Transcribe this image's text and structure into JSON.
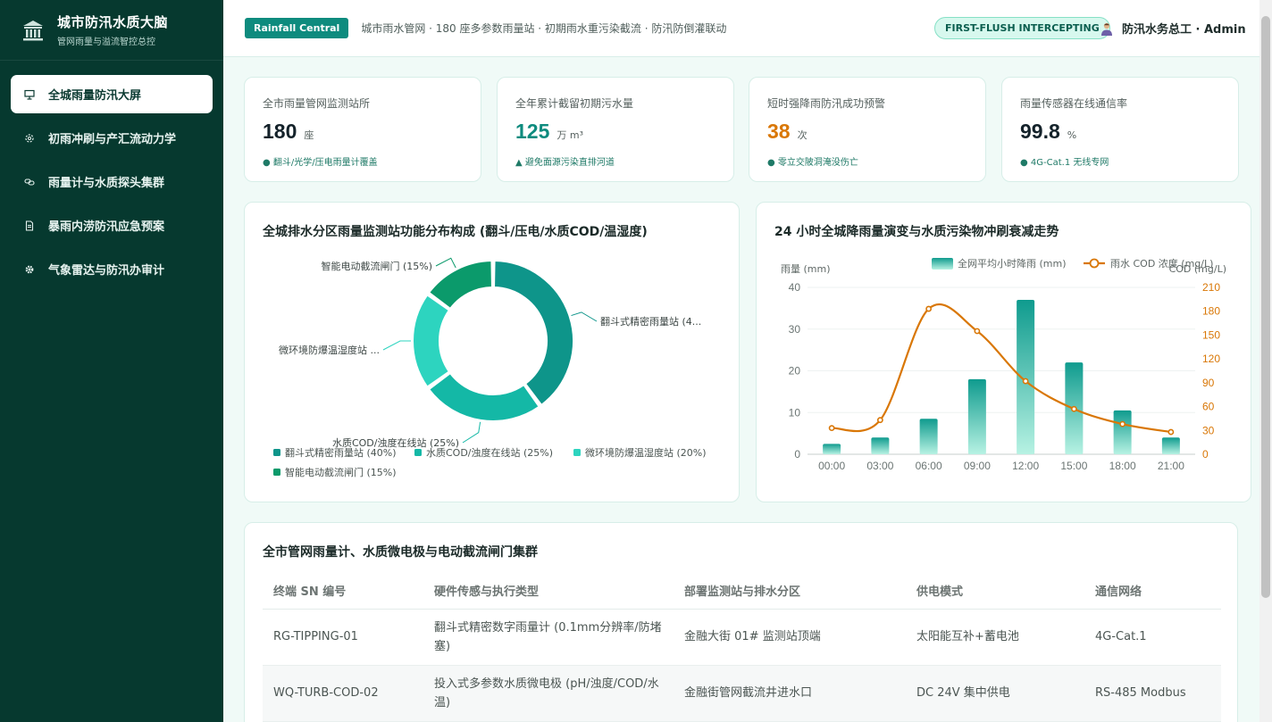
{
  "brand": {
    "title": "城市防汛水质大脑",
    "subtitle": "管网雨量与溢流智控总控"
  },
  "sidebar": {
    "items": [
      {
        "label": "全城雨量防汛大屏",
        "icon": "presentation-icon",
        "active": true
      },
      {
        "label": "初雨冲刷与产汇流动力学",
        "icon": "gear-dashed-icon",
        "active": false
      },
      {
        "label": "雨量计与水质探头集群",
        "icon": "link-icon",
        "active": false
      },
      {
        "label": "暴雨内涝防汛应急预案",
        "icon": "document-icon",
        "active": false
      },
      {
        "label": "气象雷达与防汛办审计",
        "icon": "gear-icon",
        "active": false
      }
    ]
  },
  "header": {
    "badge": "Rainfall Central",
    "description": "城市雨水管网 · 180 座多参数雨量站 · 初期雨水重污染截流 · 防汛防倒灌联动",
    "status": "FIRST-FLUSH INTERCEPTING",
    "user": "防汛水务总工 · Admin"
  },
  "kpis": [
    {
      "label": "全市雨量管网监测站所",
      "value": "180",
      "unit": "座",
      "foot": "● 翻斗/光学/压电雨量计覆盖",
      "color": "#14222a"
    },
    {
      "label": "全年累计截留初期污水量",
      "value": "125",
      "unit": "万 m³",
      "foot": "▲ 避免面源污染直排河道",
      "color": "#0e8b7e"
    },
    {
      "label": "短时强降雨防汛成功预警",
      "value": "38",
      "unit": "次",
      "foot": "● 零立交陂洞淹没伤亡",
      "color": "#d97706"
    },
    {
      "label": "雨量传感器在线通信率",
      "value": "99.8",
      "unit": "%",
      "foot": "● 4G-Cat.1 无线专网",
      "color": "#14222a"
    }
  ],
  "donut": {
    "title": "全城排水分区雨量监测站功能分布构成 (翻斗/压电/水质COD/温湿度)",
    "callouts": [
      "翻斗式精密雨量站 (4...",
      "水质COD/浊度在线站 (25%)",
      "微环境防爆温湿度站 ...",
      "智能电动截流闸门 (15%)"
    ],
    "legend": [
      "翻斗式精密雨量站 (40%)",
      "水质COD/浊度在线站 (25%)",
      "微环境防爆温湿度站 (20%)",
      "智能电动截流闸门 (15%)"
    ]
  },
  "trend": {
    "title": "24 小时全城降雨量演变与水质污染物冲刷衰减走势",
    "y_left_label": "雨量 (mm)",
    "y_right_label": "COD (mg/L)",
    "legend_bar": "全网平均小时降雨 (mm)",
    "legend_line": "雨水 COD 浓度 (mg/L)"
  },
  "table": {
    "title": "全市管网雨量计、水质微电极与电动截流闸门集群",
    "headers": [
      "终端 SN 编号",
      "硬件传感与执行类型",
      "部署监测站与排水分区",
      "供电模式",
      "通信网络"
    ],
    "rows": [
      [
        "RG-TIPPING-01",
        "翻斗式精密数字雨量计 (0.1mm分辨率/防堵塞)",
        "金融大街 01# 监测站顶端",
        "太阳能互补+蓄电池",
        "4G-Cat.1"
      ],
      [
        "WQ-TURB-COD-02",
        "投入式多参数水质微电极 (pH/浊度/COD/水温)",
        "金融街管网截流井进水口",
        "DC 24V 集中供电",
        "RS-485 Modbus"
      ]
    ]
  },
  "chart_data": [
    {
      "type": "pie",
      "title": "全城排水分区雨量监测站功能分布构成 (翻斗/压电/水质COD/温湿度)",
      "categories": [
        "翻斗式精密雨量站",
        "水质COD/浊度在线站",
        "微环境防爆温湿度站",
        "智能电动截流闸门"
      ],
      "values": [
        40,
        25,
        20,
        15
      ],
      "colors": [
        "#0e958a",
        "#14b8a6",
        "#2dd4bf",
        "#0b9a6b"
      ],
      "legend_position": "bottom"
    },
    {
      "type": "bar",
      "title": "24 小时全城降雨量演变与水质污染物冲刷衰减走势",
      "categories": [
        "00:00",
        "03:00",
        "06:00",
        "09:00",
        "12:00",
        "15:00",
        "18:00",
        "21:00"
      ],
      "series": [
        {
          "name": "全网平均小时降雨 (mm)",
          "type": "bar",
          "axis": "left",
          "color": "#14b8a6",
          "values": [
            2.5,
            4,
            8.5,
            18,
            37,
            22,
            10.5,
            4
          ]
        },
        {
          "name": "雨水 COD 浓度 (mg/L)",
          "type": "line",
          "axis": "right",
          "color": "#d97706",
          "values": [
            33,
            43,
            183,
            155,
            92,
            57,
            38,
            28
          ]
        }
      ],
      "ylabel": "雨量 (mm)",
      "ylabel_right": "COD (mg/L)",
      "ylim": [
        0,
        40
      ],
      "yticks": [
        0,
        10,
        20,
        30,
        40
      ],
      "ylim_right": [
        0,
        210
      ],
      "yticks_right": [
        0,
        30,
        60,
        90,
        120,
        150,
        180,
        210
      ],
      "legend_position": "top",
      "grid": true
    }
  ]
}
